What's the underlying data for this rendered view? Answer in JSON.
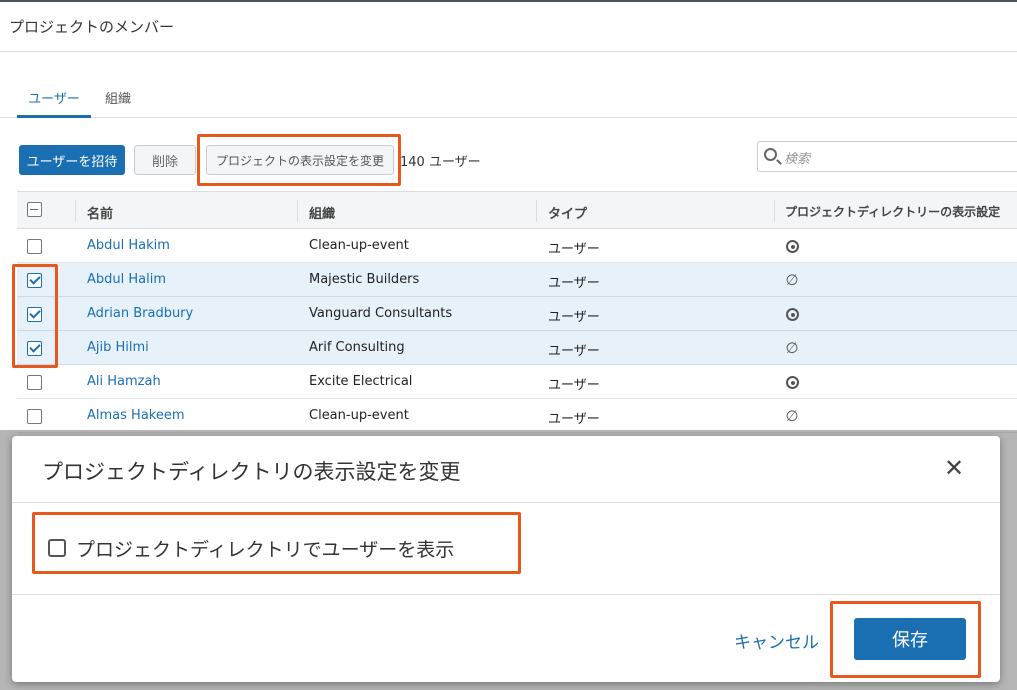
{
  "panel": {
    "title": "プロジェクトのメンバー"
  },
  "tabs": [
    {
      "label": "ユーザー",
      "active": true
    },
    {
      "label": "組織",
      "active": false
    }
  ],
  "toolbar": {
    "invite_label": "ユーザーを招待",
    "delete_label": "削除",
    "visibility_label": "プロジェクトの表示設定を変更",
    "user_count": "140 ユーザー",
    "search_placeholder": "検索"
  },
  "table": {
    "columns": [
      "名前",
      "組織",
      "タイプ",
      "プロジェクトディレクトリーの表示設定"
    ],
    "rows": [
      {
        "name": "Abdul Hakim",
        "org": "Clean-up-event",
        "type": "ユーザー",
        "selected": false,
        "visibility_icon": "eye-icon"
      },
      {
        "name": "Abdul Halim",
        "org": "Majestic Builders",
        "type": "ユーザー",
        "selected": true,
        "visibility_icon": "hidden-icon"
      },
      {
        "name": "Adrian Bradbury",
        "org": "Vanguard Consultants",
        "type": "ユーザー",
        "selected": true,
        "visibility_icon": "eye-icon"
      },
      {
        "name": "Ajib Hilmi",
        "org": "Arif Consulting",
        "type": "ユーザー",
        "selected": true,
        "visibility_icon": "hidden-icon"
      },
      {
        "name": "Ali Hamzah",
        "org": "Excite Electrical",
        "type": "ユーザー",
        "selected": false,
        "visibility_icon": "eye-icon"
      },
      {
        "name": "Almas Hakeem",
        "org": "Clean-up-event",
        "type": "ユーザー",
        "selected": false,
        "visibility_icon": "hidden-icon"
      }
    ]
  },
  "modal": {
    "title": "プロジェクトディレクトリの表示設定を変更",
    "checkbox_label": "プロジェクトディレクトリでユーザーを表示",
    "cancel_label": "キャンセル",
    "save_label": "保存"
  },
  "colors": {
    "primary": "#1a6fb3",
    "highlight": "#e8571c",
    "selected_row": "#e7f1fa"
  }
}
